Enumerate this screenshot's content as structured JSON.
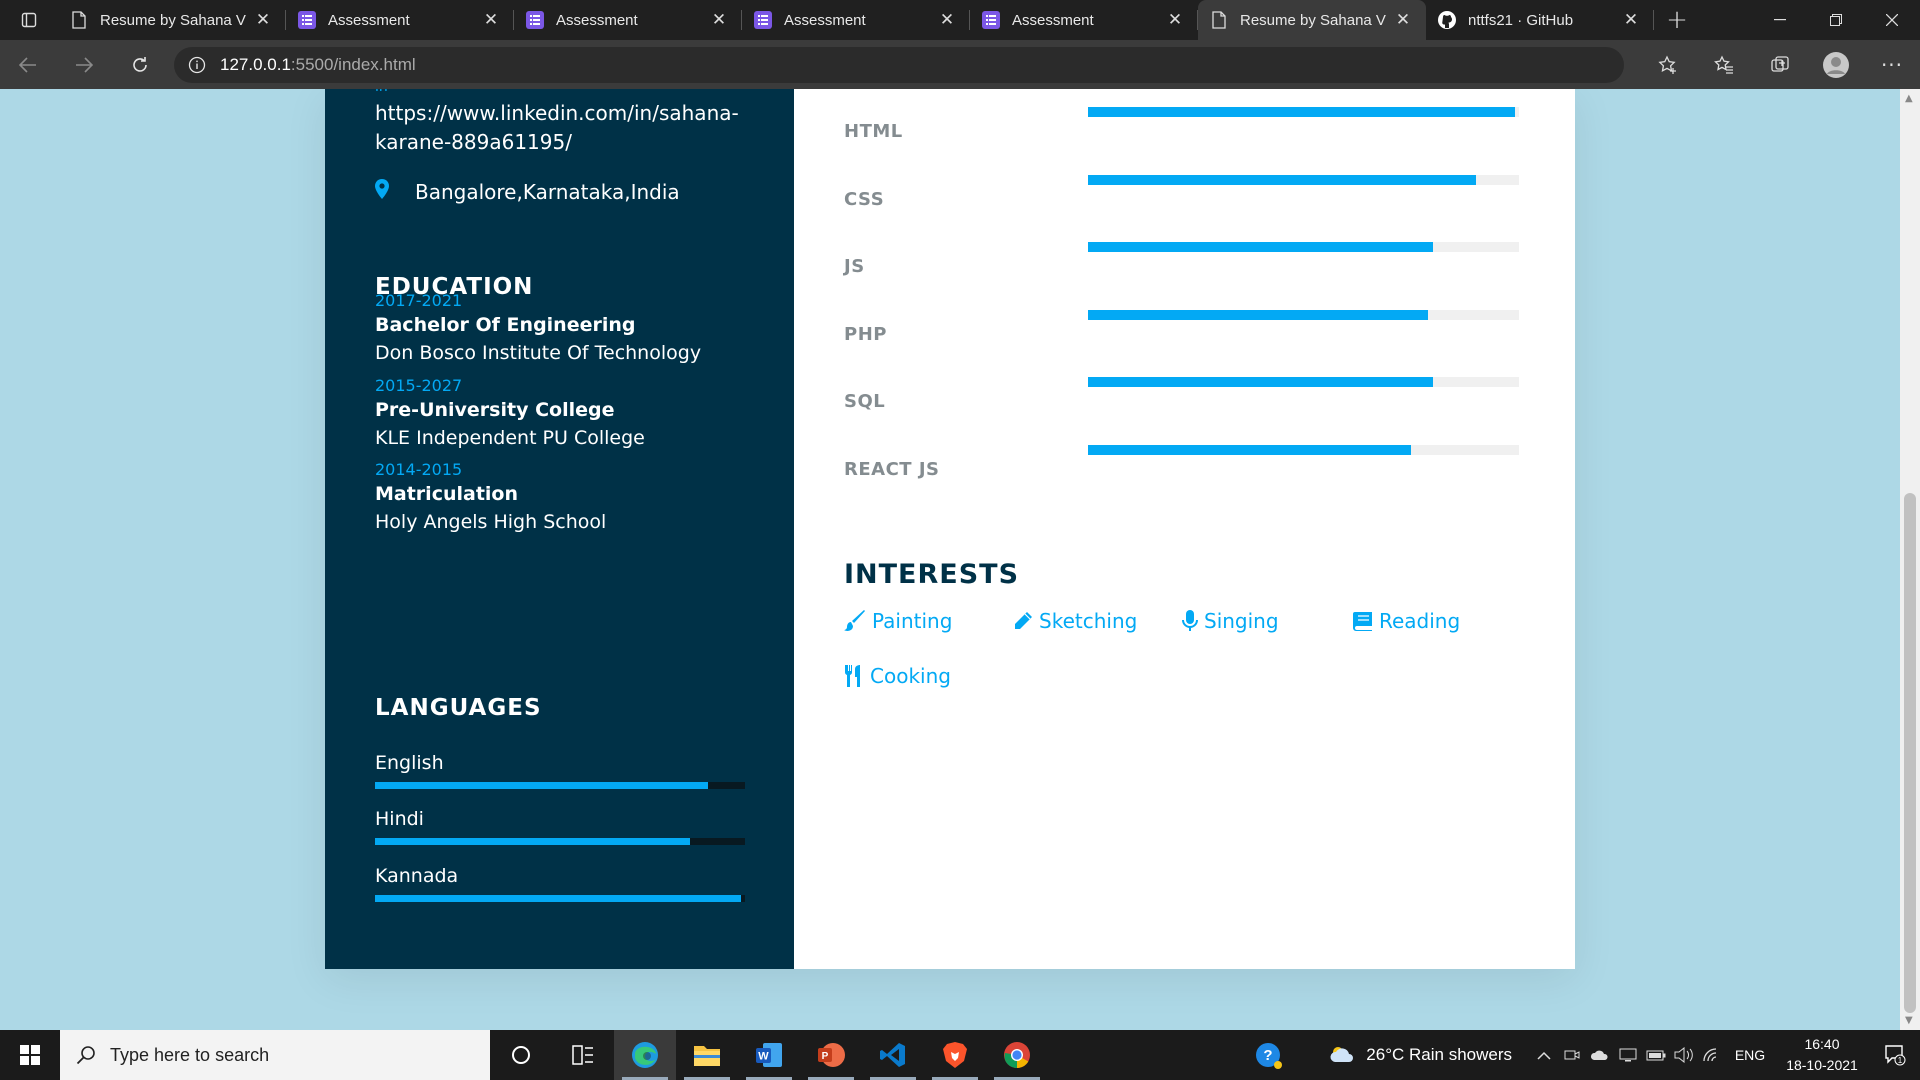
{
  "browser": {
    "tabs": [
      {
        "title": "Resume by Sahana V",
        "icon": "page-icon",
        "active": false
      },
      {
        "title": "Assessment",
        "icon": "forms-icon",
        "active": false
      },
      {
        "title": "Assessment",
        "icon": "forms-icon",
        "active": false
      },
      {
        "title": "Assessment",
        "icon": "forms-icon",
        "active": false
      },
      {
        "title": "Assessment",
        "icon": "forms-icon",
        "active": false
      },
      {
        "title": "Resume by Sahana V",
        "icon": "page-icon",
        "active": true
      },
      {
        "title": "nttfs21 · GitHub",
        "icon": "github-icon",
        "active": false
      }
    ],
    "address": {
      "host": "127.0.0.1",
      "path": ":5500/index.html"
    }
  },
  "resume": {
    "contact": {
      "linkedin_line1": "https://www.linkedin.com/in/sahana-",
      "linkedin_line2": "karane-889a61195/",
      "location": "Bangalore,Karnataka,India"
    },
    "education_title": "EDUCATION",
    "education": [
      {
        "years": "2017-2021",
        "degree": "Bachelor Of Engineering",
        "institute": "Don Bosco Institute Of Technology"
      },
      {
        "years": "2015-2027",
        "degree": "Pre-University College",
        "institute": "KLE Independent PU College"
      },
      {
        "years": "2014-2015",
        "degree": "Matriculation",
        "institute": "Holy Angels High School"
      }
    ],
    "languages_title": "LANGUAGES",
    "languages": [
      {
        "name": "English",
        "level": 0.9
      },
      {
        "name": "Hindi",
        "level": 0.85
      },
      {
        "name": "Kannada",
        "level": 0.99
      }
    ],
    "skills": [
      {
        "name": "HTML",
        "level": 0.99
      },
      {
        "name": "CSS",
        "level": 0.9
      },
      {
        "name": "JS",
        "level": 0.8
      },
      {
        "name": "PHP",
        "level": 0.79
      },
      {
        "name": "SQL",
        "level": 0.8
      },
      {
        "name": "REACT JS",
        "level": 0.75
      }
    ],
    "interests_title": "INTERESTS",
    "interests": [
      {
        "name": "Painting",
        "icon": "paint-brush-icon"
      },
      {
        "name": "Sketching",
        "icon": "pencil-icon"
      },
      {
        "name": "Singing",
        "icon": "microphone-icon"
      },
      {
        "name": "Reading",
        "icon": "book-icon"
      },
      {
        "name": "Cooking",
        "icon": "utensils-icon"
      }
    ],
    "accent_color": "#03a9f4",
    "sidebar_color": "#003147"
  },
  "taskbar": {
    "search_placeholder": "Type here to search",
    "weather": "26°C  Rain showers",
    "lang": "ENG",
    "time": "16:40",
    "date": "18-10-2021",
    "notifications": "1"
  }
}
